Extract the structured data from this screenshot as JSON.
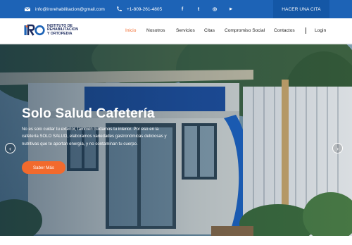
{
  "topbar": {
    "email": "info@irorehabilitacion@gmail.com",
    "phone": "+1-809-261-4805",
    "social": [
      {
        "icon": "facebook-icon",
        "glyph": "f"
      },
      {
        "icon": "twitter-icon",
        "glyph": "t"
      },
      {
        "icon": "instagram-icon",
        "glyph": "◎"
      },
      {
        "icon": "youtube-icon",
        "glyph": "▶"
      }
    ],
    "cta_label": "HACER UNA CITA"
  },
  "logo": {
    "line1": "INSTITUTO DE",
    "line2": "REHABILITACION",
    "line3": "Y ORTOPEDIA"
  },
  "nav": {
    "items": [
      "Inicio",
      "Nosotros",
      "Servicios",
      "Citas",
      "Compromiso Social",
      "Contactos"
    ],
    "active": "Inicio",
    "login": "Login"
  },
  "hero": {
    "title": "Solo Salud Cafetería",
    "text": "No es solo cuidar tu exterior, también cuidamos tu interior. Por eso en la cafetería SOLO SALUD, elaboramos variedades gastronómicas deliciosas y nutritivas que te aportan energía, y no contaminan tu cuerpo.",
    "button": "Saber Más",
    "prev": "‹",
    "next": "›"
  },
  "colors": {
    "topbar": "#1d63b6",
    "accent": "#f26a2d",
    "nav_text": "#222222"
  }
}
